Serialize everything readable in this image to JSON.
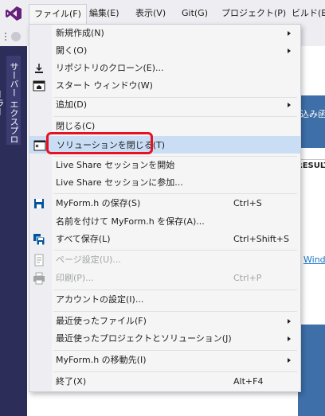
{
  "menubar": {
    "items": [
      {
        "label": "ファイル(F)"
      },
      {
        "label": "編集(E)"
      },
      {
        "label": "表示(V)"
      },
      {
        "label": "Git(G)"
      },
      {
        "label": "プロジェクト(P)"
      },
      {
        "label": "ビルド(B)"
      }
    ]
  },
  "side_panel": {
    "server_explorer": "サーバー エクスプローラー"
  },
  "background": {
    "banner_text": "込み函",
    "result_text": "RESULT",
    "link_text": "Wind"
  },
  "file_menu": {
    "new": "新規作成(N)",
    "open": "開く(O)",
    "clone": "リポジトリのクローン(E)...",
    "start_window": "スタート ウィンドウ(W)",
    "add": "追加(D)",
    "close": "閉じる(C)",
    "close_solution": "ソリューションを閉じる(T)",
    "live_share_start": "Live Share セッションを開始",
    "live_share_join": "Live Share セッションに参加...",
    "save_file": "MyForm.h の保存(S)",
    "save_file_shortcut": "Ctrl+S",
    "save_as": "名前を付けて MyForm.h を保存(A)...",
    "save_all": "すべて保存(L)",
    "save_all_shortcut": "Ctrl+Shift+S",
    "page_setup": "ページ設定(U)...",
    "print": "印刷(P)...",
    "print_shortcut": "Ctrl+P",
    "account_settings": "アカウントの設定(I)...",
    "recent_files": "最近使ったファイル(F)",
    "recent_projects": "最近使ったプロジェクトとソリューション(J)",
    "move_file": "MyForm.h の移動先(I)",
    "exit": "終了(X)",
    "exit_shortcut": "Alt+F4"
  },
  "colors": {
    "highlight": "#c9def5",
    "annotation_box": "#e81123",
    "vs_purple": "#68217a"
  }
}
